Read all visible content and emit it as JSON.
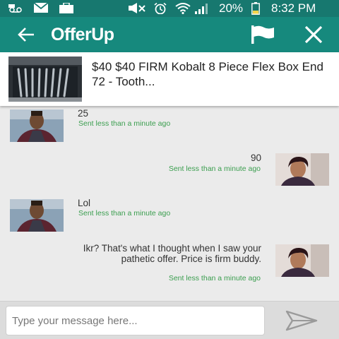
{
  "status_bar": {
    "battery": "20%",
    "time": "8:32 PM",
    "icons": [
      "voicemail-icon",
      "email-icon",
      "briefcase-icon",
      "mute-icon",
      "alarm-icon",
      "wifi-icon",
      "signal-icon",
      "battery-icon"
    ]
  },
  "app_bar": {
    "logo": "OfferUp",
    "icons": [
      "back-arrow-icon",
      "flag-icon",
      "close-icon"
    ],
    "color": "#16897d"
  },
  "listing": {
    "title": "$40 $40 FIRM Kobalt 8 Piece Flex Box End 72 - Tooth..."
  },
  "messages": [
    {
      "side": "left",
      "text": "25",
      "time": "Sent less than a minute ago"
    },
    {
      "side": "right",
      "text": "90",
      "time": "Sent less than a minute ago"
    },
    {
      "side": "left",
      "text": "Lol",
      "time": "Sent less than a minute ago"
    },
    {
      "side": "right",
      "text": "Ikr? That's what I thought when I saw your pathetic offer. Price is firm buddy.",
      "time": "Sent less than a minute ago"
    }
  ],
  "composer": {
    "placeholder": "Type your message here..."
  },
  "colors": {
    "status_bar": "#17786f",
    "timestamp": "#3b9e4f"
  }
}
